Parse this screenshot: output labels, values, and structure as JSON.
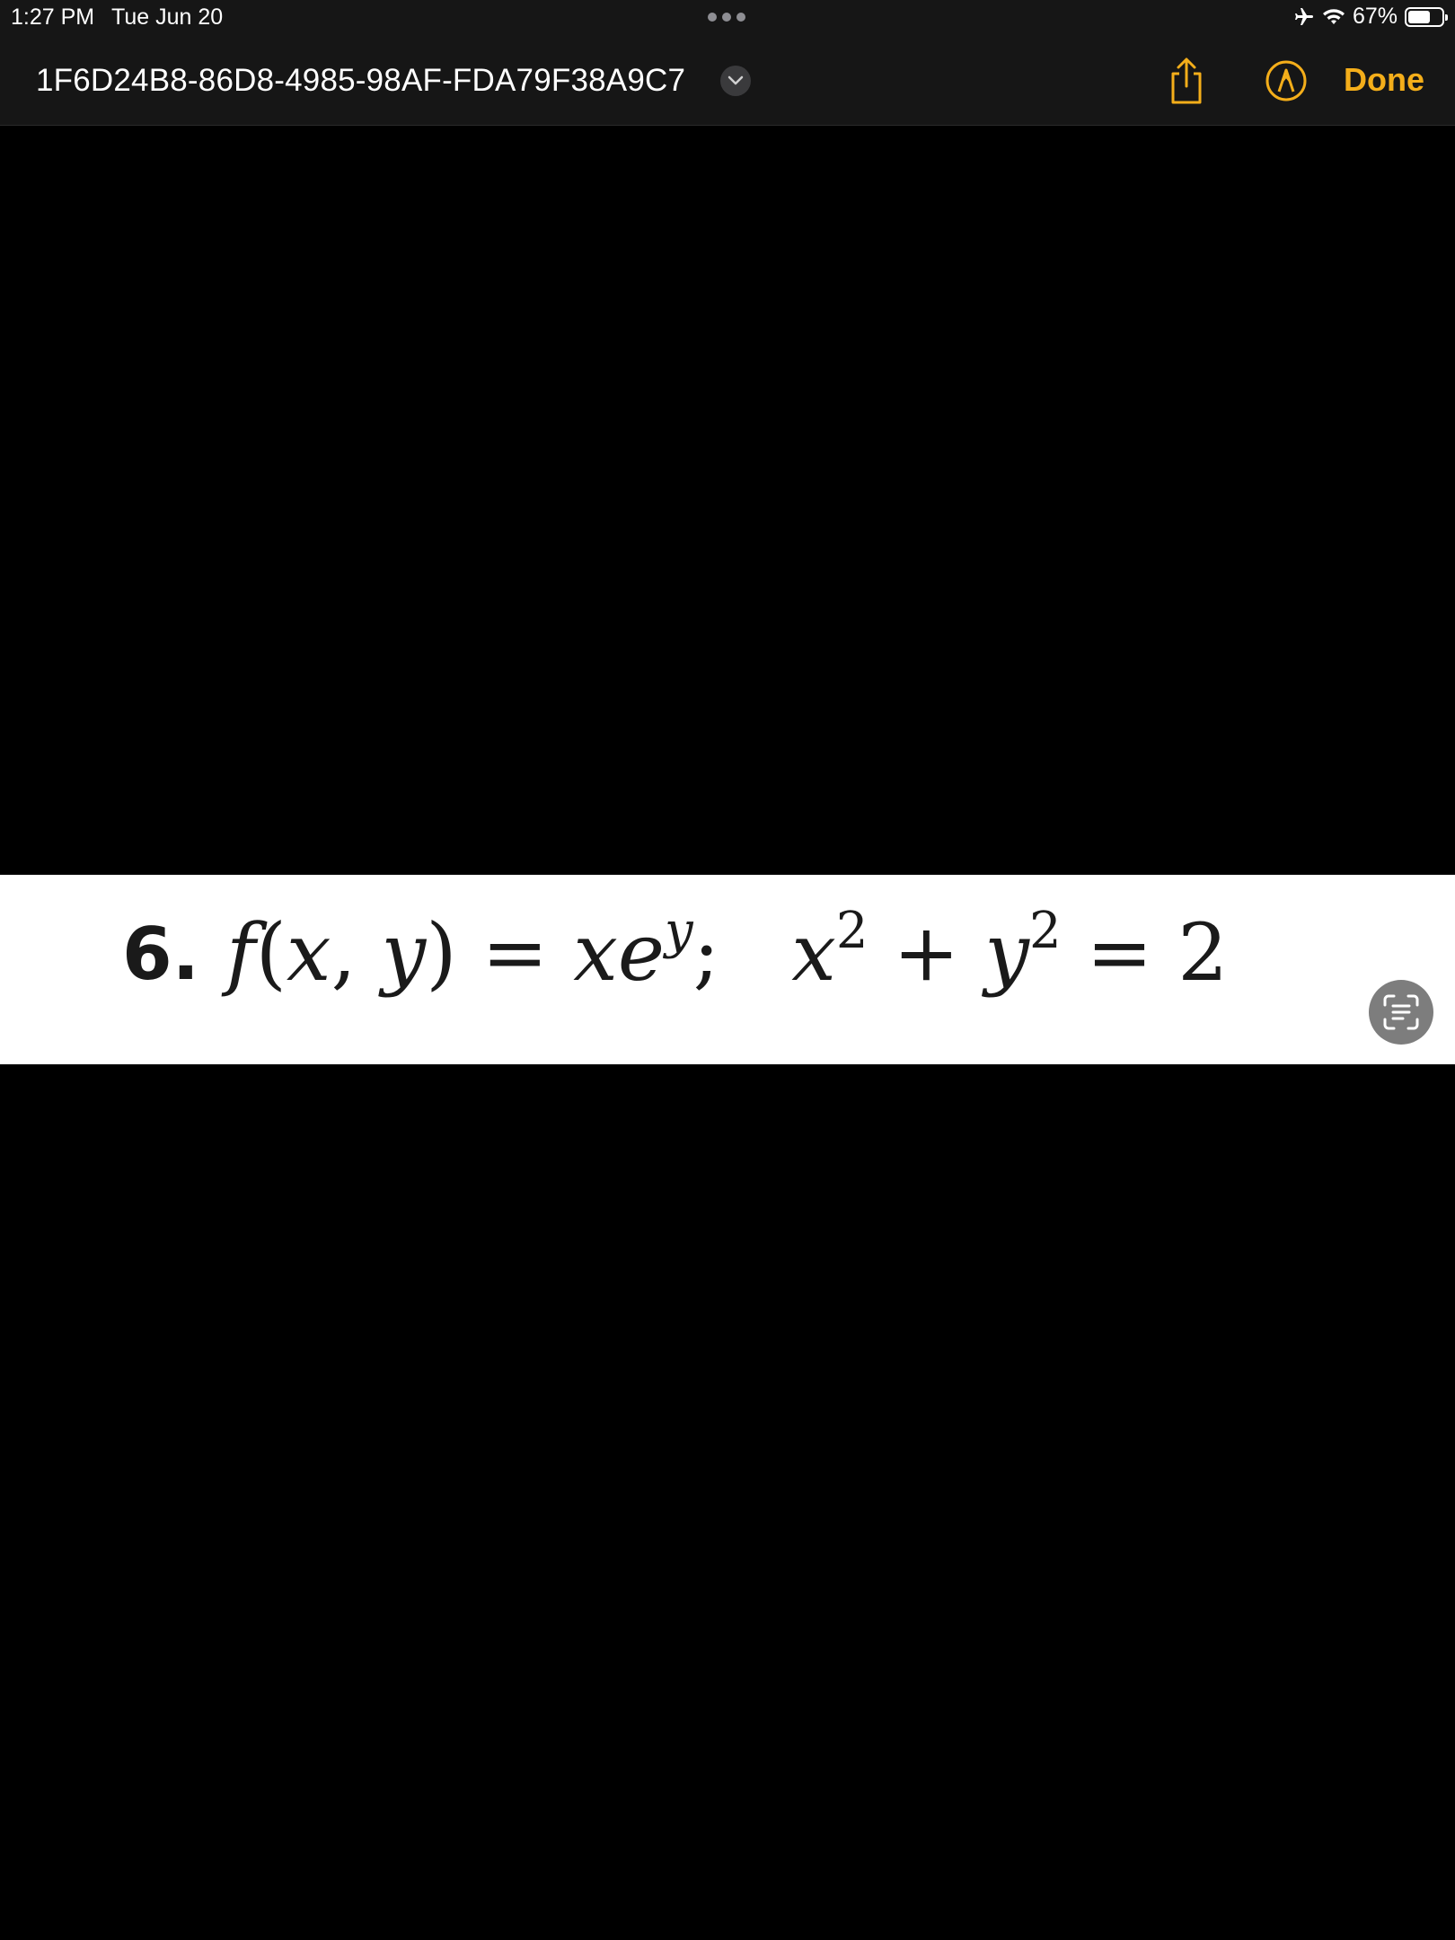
{
  "status_bar": {
    "time": "1:27 PM",
    "date": "Tue Jun 20",
    "battery": "67%",
    "battery_level": 0.67,
    "icons": [
      "airplane-icon",
      "wifi-icon",
      "battery-icon"
    ]
  },
  "toolbar": {
    "title": "1F6D24B8-86D8-4985-98AF-FDA79F38A9C7",
    "done_label": "Done",
    "accent_color": "#F4AE1A",
    "icons": [
      "chevron-down-icon",
      "share-icon",
      "markup-icon"
    ]
  },
  "problem": {
    "number": "6.",
    "f": "f",
    "open_paren": "(",
    "x1": "x",
    "comma": ", ",
    "y1": "y",
    "close_paren": ")",
    "eq1": " = ",
    "x2": "x",
    "e": "e",
    "exp_y": "y",
    "semicolon": ";",
    "x3": "x",
    "exp2a": "2",
    "plus": " + ",
    "y3": "y",
    "exp2b": "2",
    "eq2": " = ",
    "rhs": "2"
  },
  "live_text": {
    "icon": "live-text-icon"
  }
}
